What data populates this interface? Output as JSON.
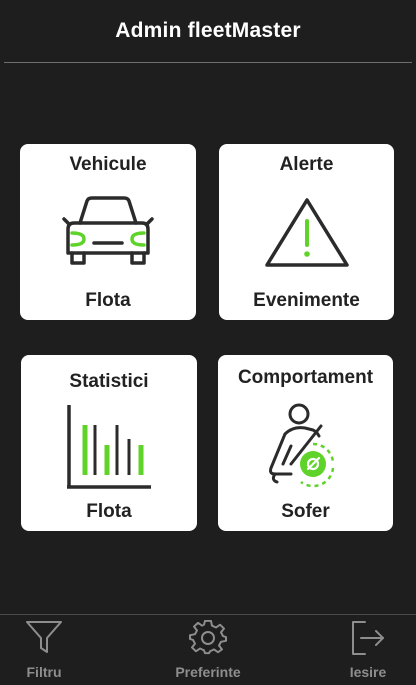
{
  "header": {
    "title": "Admin fleetMaster"
  },
  "tiles": {
    "vehicule": {
      "title": "Vehicule",
      "subtitle": "Flota",
      "icon": "car-icon"
    },
    "alerte": {
      "title": "Alerte",
      "subtitle": "Evenimente",
      "icon": "warning-icon"
    },
    "statistici": {
      "title": "Statistici",
      "subtitle": "Flota",
      "icon": "bar-chart-icon"
    },
    "comportament": {
      "title": "Comportament",
      "subtitle": "Sofer",
      "icon": "driver-seatbelt-icon"
    }
  },
  "nav": {
    "filtru": {
      "label": "Filtru",
      "icon": "filter-icon"
    },
    "preferinte": {
      "label": "Preferinte",
      "icon": "gear-icon"
    },
    "iesire": {
      "label": "Iesire",
      "icon": "logout-icon"
    }
  },
  "colors": {
    "background": "#1e1e1e",
    "tile": "#ffffff",
    "accent": "#5fd32a",
    "icon_dark": "#2b2b2b",
    "nav_text": "#8e8e8e"
  }
}
